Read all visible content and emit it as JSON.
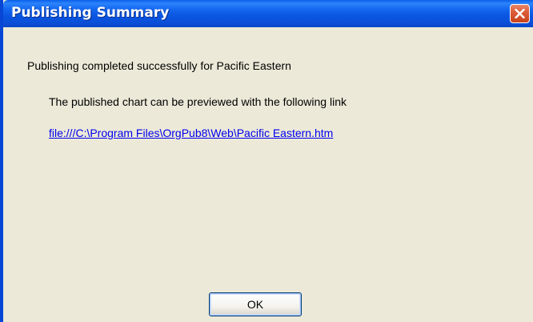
{
  "window": {
    "title": "Publishing Summary"
  },
  "message": {
    "main": "Publishing completed successfully for Pacific Eastern",
    "sub": "The published chart can be previewed with the following link",
    "link": "file:///C:\\Program Files\\OrgPub8\\Web\\Pacific Eastern.htm"
  },
  "buttons": {
    "ok_label": "OK"
  },
  "icons": {
    "close": "close-icon"
  },
  "colors": {
    "titlebar": "#0a55e0",
    "close_button": "#dd5c38",
    "dialog_background": "#ece9d8",
    "link": "#0000ee"
  }
}
